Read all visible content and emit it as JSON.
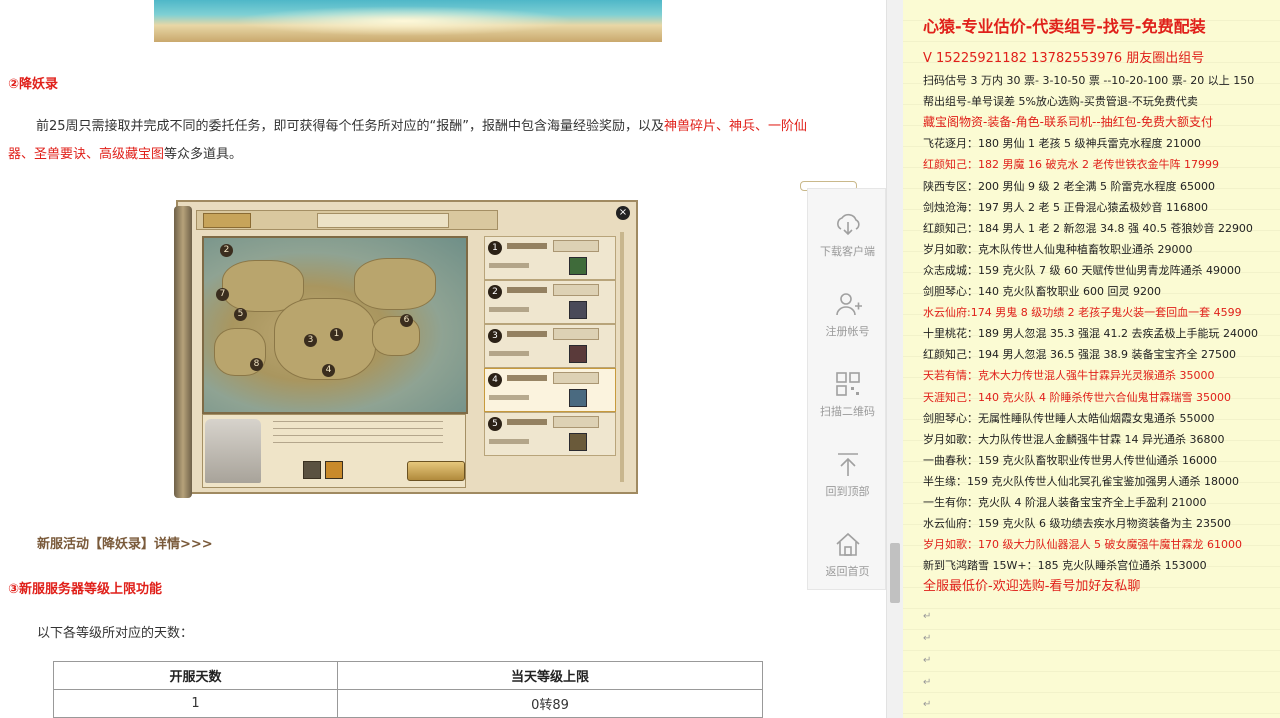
{
  "article": {
    "section2_title": "②降妖录",
    "para1_a": "前25周只需接取并完成不同的委托任务，即可获得每个任务所对应的“报酬”，报酬中包含海量经验奖励，以及",
    "para1_hl1": "神兽碎片、",
    "para1_hl2": "神兵、一阶仙器、圣兽要诀、高级藏宝图",
    "para1_end": "等众多道具。",
    "link_text": "新服活动【降妖录】详情>>>",
    "section3_title": "③新服服务器等级上限功能",
    "table_intro": "以下各等级所对应的天数：",
    "table": {
      "headers": [
        "开服天数",
        "当天等级上限"
      ],
      "rows": [
        [
          "1",
          "0转89"
        ]
      ]
    }
  },
  "game_image": {
    "map_numbers": [
      "1",
      "2",
      "3",
      "4",
      "5",
      "6",
      "7",
      "8"
    ],
    "list_numbers": [
      "1",
      "2",
      "3",
      "4",
      "5"
    ]
  },
  "toolbar": {
    "items": [
      {
        "label": "下载客户端",
        "icon": "cloud-download-icon"
      },
      {
        "label": "注册帐号",
        "icon": "user-add-icon"
      },
      {
        "label": "扫描二维码",
        "icon": "qrcode-icon"
      },
      {
        "label": "回到顶部",
        "icon": "back-to-top-icon"
      },
      {
        "label": "返回首页",
        "icon": "home-icon"
      }
    ]
  },
  "note": {
    "title": "心猿-专业估价-代卖组号-找号-免费配装",
    "contact": "V 15225921182   13782553976 朋友圈出组号",
    "lines": [
      {
        "text": "扫码估号 3 万内 30 票- 3-10-50 票  --10-20-100 票- 20 以上 150",
        "style": "normal"
      },
      {
        "text": "帮出组号-单号误差 5%放心选购-买贵管退-不玩免费代卖",
        "style": "normal"
      },
      {
        "text": "藏宝阁物资-装备-角色-联系司机--抽红包-免费大额支付",
        "style": "redb"
      },
      {
        "text": "飞花逐月：180 男仙 1 老孩 5 级神兵雷克水程度 21000",
        "style": "normal"
      },
      {
        "text": "红颜知己：182 男魔 16 破克水 2 老传世铁衣金牛阵 17999",
        "style": "red"
      },
      {
        "text": "陕西专区：200 男仙 9 级 2 老全满 5 阶雷克水程度 65000",
        "style": "normal"
      },
      {
        "text": "剑烛沧海：197 男人 2 老 5 正骨混心猿孟极妙音 116800",
        "style": "normal"
      },
      {
        "text": "红颜知己：184 男人 1 老 2 新忽混 34.8 强 40.5 苍狼妙音 22900",
        "style": "normal"
      },
      {
        "text": "岁月如歌：克木队传世人仙鬼种植畜牧职业通杀 29000",
        "style": "normal"
      },
      {
        "text": "众志成城：159 克火队 7 级 60 天赋传世仙男青龙阵通杀 49000",
        "style": "normal"
      },
      {
        "text": "剑胆琴心：140 克火队畜牧职业 600 回灵 9200",
        "style": "normal"
      },
      {
        "text": "水云仙府:174 男鬼 8 级功绩 2 老孩子鬼火装一套回血一套 4599",
        "style": "red"
      },
      {
        "text": "十里桃花：189 男人忽混 35.3 强混 41.2 去疾孟极上手能玩 24000",
        "style": "normal"
      },
      {
        "text": "红颜知己：194 男人忽混 36.5 强混 38.9 装备宝宝齐全 27500",
        "style": "normal"
      },
      {
        "text": "天若有情：克木大力传世混人强牛甘霖异光灵猴通杀 35000",
        "style": "red"
      },
      {
        "text": "天涯知己：140 克火队 4 阶睡杀传世六合仙鬼甘霖瑞雪 35000",
        "style": "red"
      },
      {
        "text": "剑胆琴心：无属性睡队传世睡人太皓仙烟霞女鬼通杀 55000",
        "style": "normal"
      },
      {
        "text": "岁月如歌：大力队传世混人金麟强牛甘霖 14 异光通杀 36800",
        "style": "normal"
      },
      {
        "text": "一曲春秋：159 克火队畜牧职业传世男人传世仙通杀 16000",
        "style": "normal"
      },
      {
        "text": "半生缘：159 克火队传世人仙北冥孔雀宝鉴加强男人通杀 18000",
        "style": "normal"
      },
      {
        "text": "一生有你：克火队 4 阶混人装备宝宝齐全上手盈利 21000",
        "style": "normal"
      },
      {
        "text": "水云仙府：159 克火队 6 级功绩去疾水月物资装备为主 23500",
        "style": "normal"
      },
      {
        "text": "岁月如歌：170 级大力队仙器混人 5 破女魔强牛魔甘霖龙 61000",
        "style": "red"
      },
      {
        "text": "新到飞鸿踏雪 15W+：185 克火队睡杀宫位通杀 153000",
        "style": "normal"
      },
      {
        "text": "全服最低价-欢迎选购-看号加好友私聊",
        "style": "mid"
      }
    ],
    "return_mark": "↵"
  }
}
